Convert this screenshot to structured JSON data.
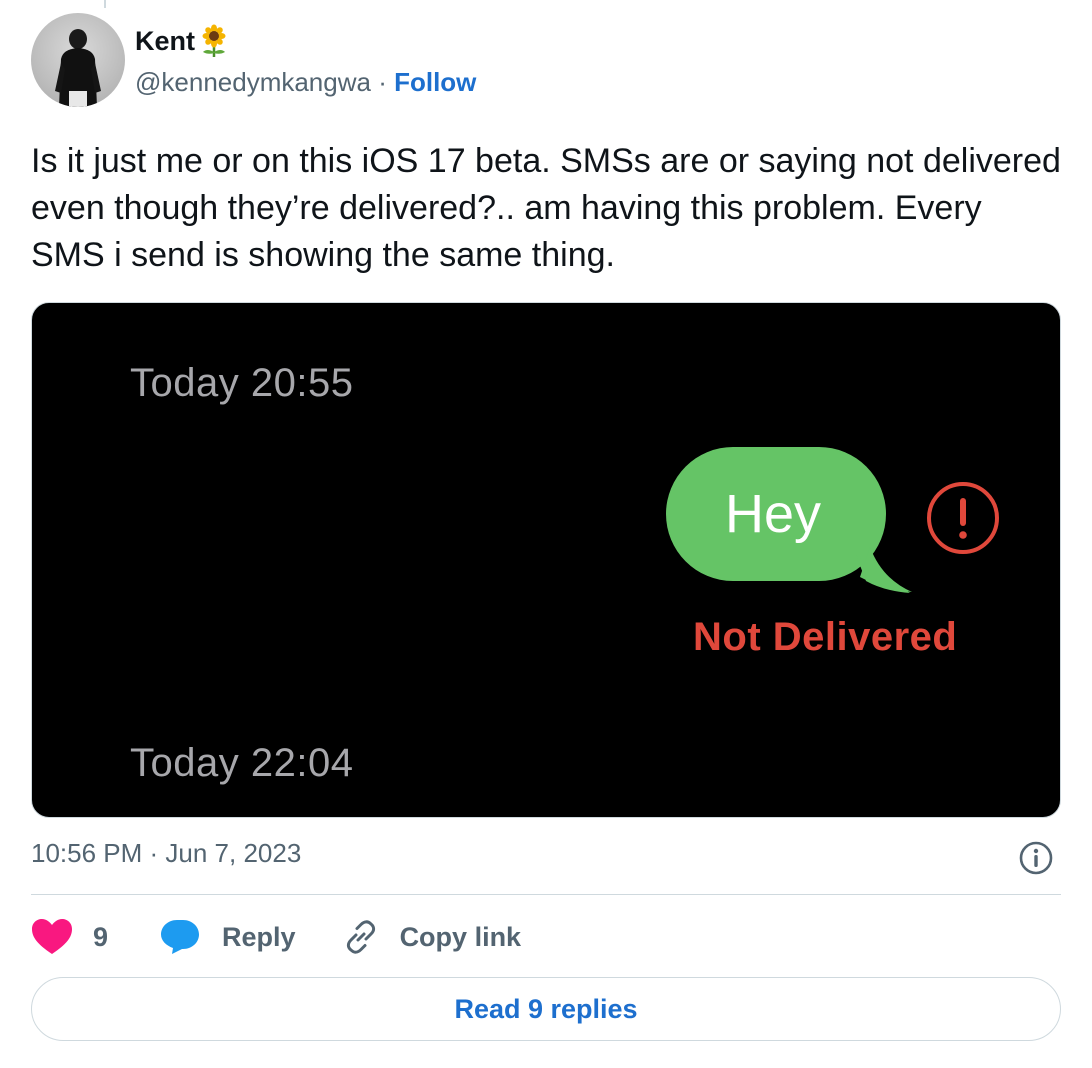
{
  "author": {
    "name": "Kent",
    "emoji": "sunflower",
    "handle": "@kennedymkangwa",
    "separator": "·",
    "follow_label": "Follow"
  },
  "tweet": {
    "text": "Is it just me or on this iOS 17 beta. SMSs are or saying not delivered even though they’re delivered?.. am having this problem. Every SMS i send is showing the same thing."
  },
  "media": {
    "timestamp_1": "Today 20:55",
    "bubble_text": "Hey",
    "status_text": "Not Delivered",
    "timestamp_2": "Today 22:04",
    "bubble_color": "#65c466",
    "error_color": "#e0483b",
    "background": "#000000"
  },
  "meta": {
    "posted_at": "10:56 PM · Jun 7, 2023",
    "info_icon": "info-icon"
  },
  "actions": {
    "like_count": "9",
    "reply_label": "Reply",
    "copy_link_label": "Copy link",
    "like_color": "#f91880",
    "reply_icon_color": "#1d9bf0"
  },
  "read_replies_label": "Read 9 replies",
  "accent_color": "#1d6fce"
}
